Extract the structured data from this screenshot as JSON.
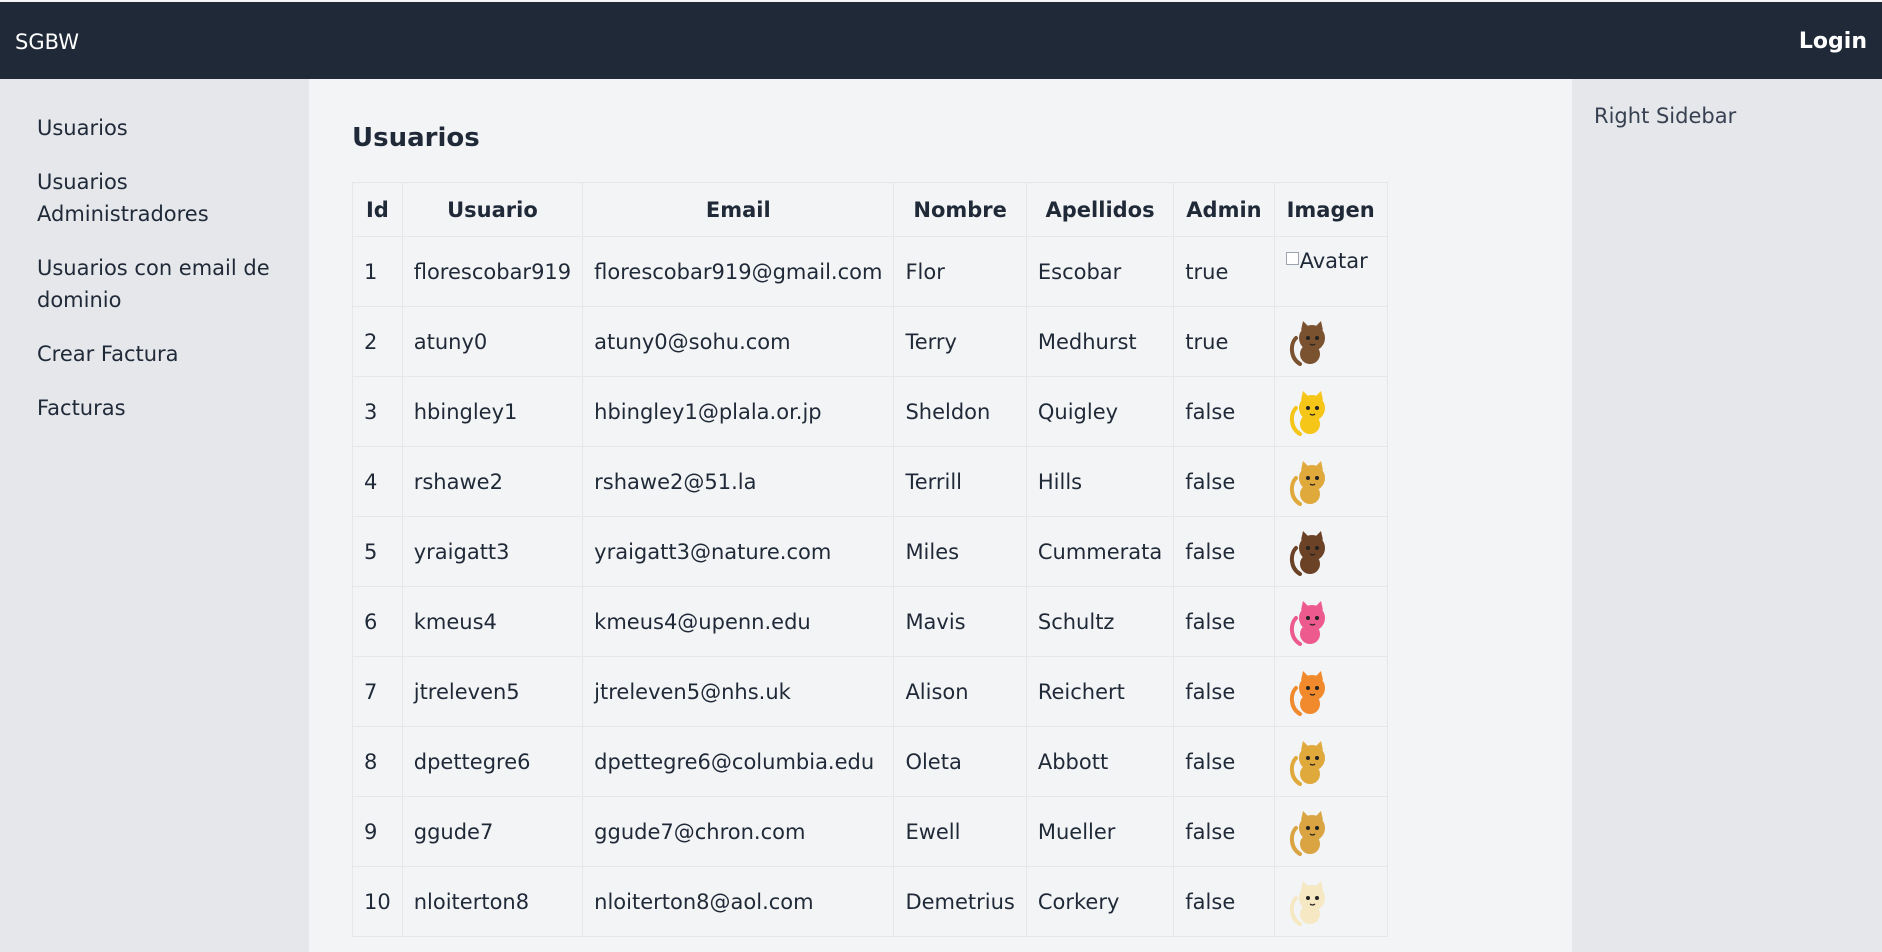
{
  "header": {
    "brand": "SGBW",
    "login_label": "Login"
  },
  "sidebar": {
    "items": [
      {
        "label": "Usuarios"
      },
      {
        "label": "Usuarios Administradores"
      },
      {
        "label": "Usuarios con email de dominio"
      },
      {
        "label": "Crear Factura"
      },
      {
        "label": "Facturas"
      }
    ]
  },
  "main": {
    "title": "Usuarios",
    "table": {
      "columns": [
        "Id",
        "Usuario",
        "Email",
        "Nombre",
        "Apellidos",
        "Admin",
        "Imagen"
      ],
      "broken_image_alt": "Avatar",
      "rows": [
        {
          "id": "1",
          "usuario": "florescobar919",
          "email": "florescobar919@gmail.com",
          "nombre": "Flor",
          "apellidos": "Escobar",
          "admin": "true",
          "avatar_color": ""
        },
        {
          "id": "2",
          "usuario": "atuny0",
          "email": "atuny0@sohu.com",
          "nombre": "Terry",
          "apellidos": "Medhurst",
          "admin": "true",
          "avatar_color": "#7a5230"
        },
        {
          "id": "3",
          "usuario": "hbingley1",
          "email": "hbingley1@plala.or.jp",
          "nombre": "Sheldon",
          "apellidos": "Quigley",
          "admin": "false",
          "avatar_color": "#f5c518"
        },
        {
          "id": "4",
          "usuario": "rshawe2",
          "email": "rshawe2@51.la",
          "nombre": "Terrill",
          "apellidos": "Hills",
          "admin": "false",
          "avatar_color": "#e0a93c"
        },
        {
          "id": "5",
          "usuario": "yraigatt3",
          "email": "yraigatt3@nature.com",
          "nombre": "Miles",
          "apellidos": "Cummerata",
          "admin": "false",
          "avatar_color": "#6b4226"
        },
        {
          "id": "6",
          "usuario": "kmeus4",
          "email": "kmeus4@upenn.edu",
          "nombre": "Mavis",
          "apellidos": "Schultz",
          "admin": "false",
          "avatar_color": "#ec5a8e"
        },
        {
          "id": "7",
          "usuario": "jtreleven5",
          "email": "jtreleven5@nhs.uk",
          "nombre": "Alison",
          "apellidos": "Reichert",
          "admin": "false",
          "avatar_color": "#f08a2c"
        },
        {
          "id": "8",
          "usuario": "dpettegre6",
          "email": "dpettegre6@columbia.edu",
          "nombre": "Oleta",
          "apellidos": "Abbott",
          "admin": "false",
          "avatar_color": "#e0a93c"
        },
        {
          "id": "9",
          "usuario": "ggude7",
          "email": "ggude7@chron.com",
          "nombre": "Ewell",
          "apellidos": "Mueller",
          "admin": "false",
          "avatar_color": "#d9a441"
        },
        {
          "id": "10",
          "usuario": "nloiterton8",
          "email": "nloiterton8@aol.com",
          "nombre": "Demetrius",
          "apellidos": "Corkery",
          "admin": "false",
          "avatar_color": "#f6e8c3"
        }
      ]
    }
  },
  "right_sidebar": {
    "label": "Right Sidebar"
  }
}
